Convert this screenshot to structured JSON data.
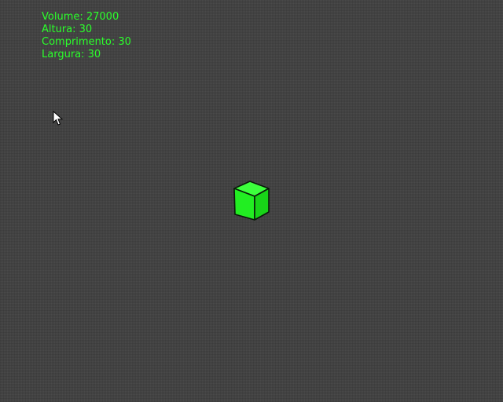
{
  "stats": {
    "volume": "Volume: 27000",
    "altura": "Altura: 30",
    "comprimento": "Comprimento: 30",
    "largura": "Largura: 30"
  },
  "colors": {
    "text": "#2bff2b",
    "cube_top": "#3cff3c",
    "cube_left": "#22ee22",
    "cube_right": "#18d418",
    "cube_edge": "#0a1a0a",
    "background": "#4a4a4a"
  },
  "icons": {
    "pointer": "mouse-pointer-icon"
  }
}
